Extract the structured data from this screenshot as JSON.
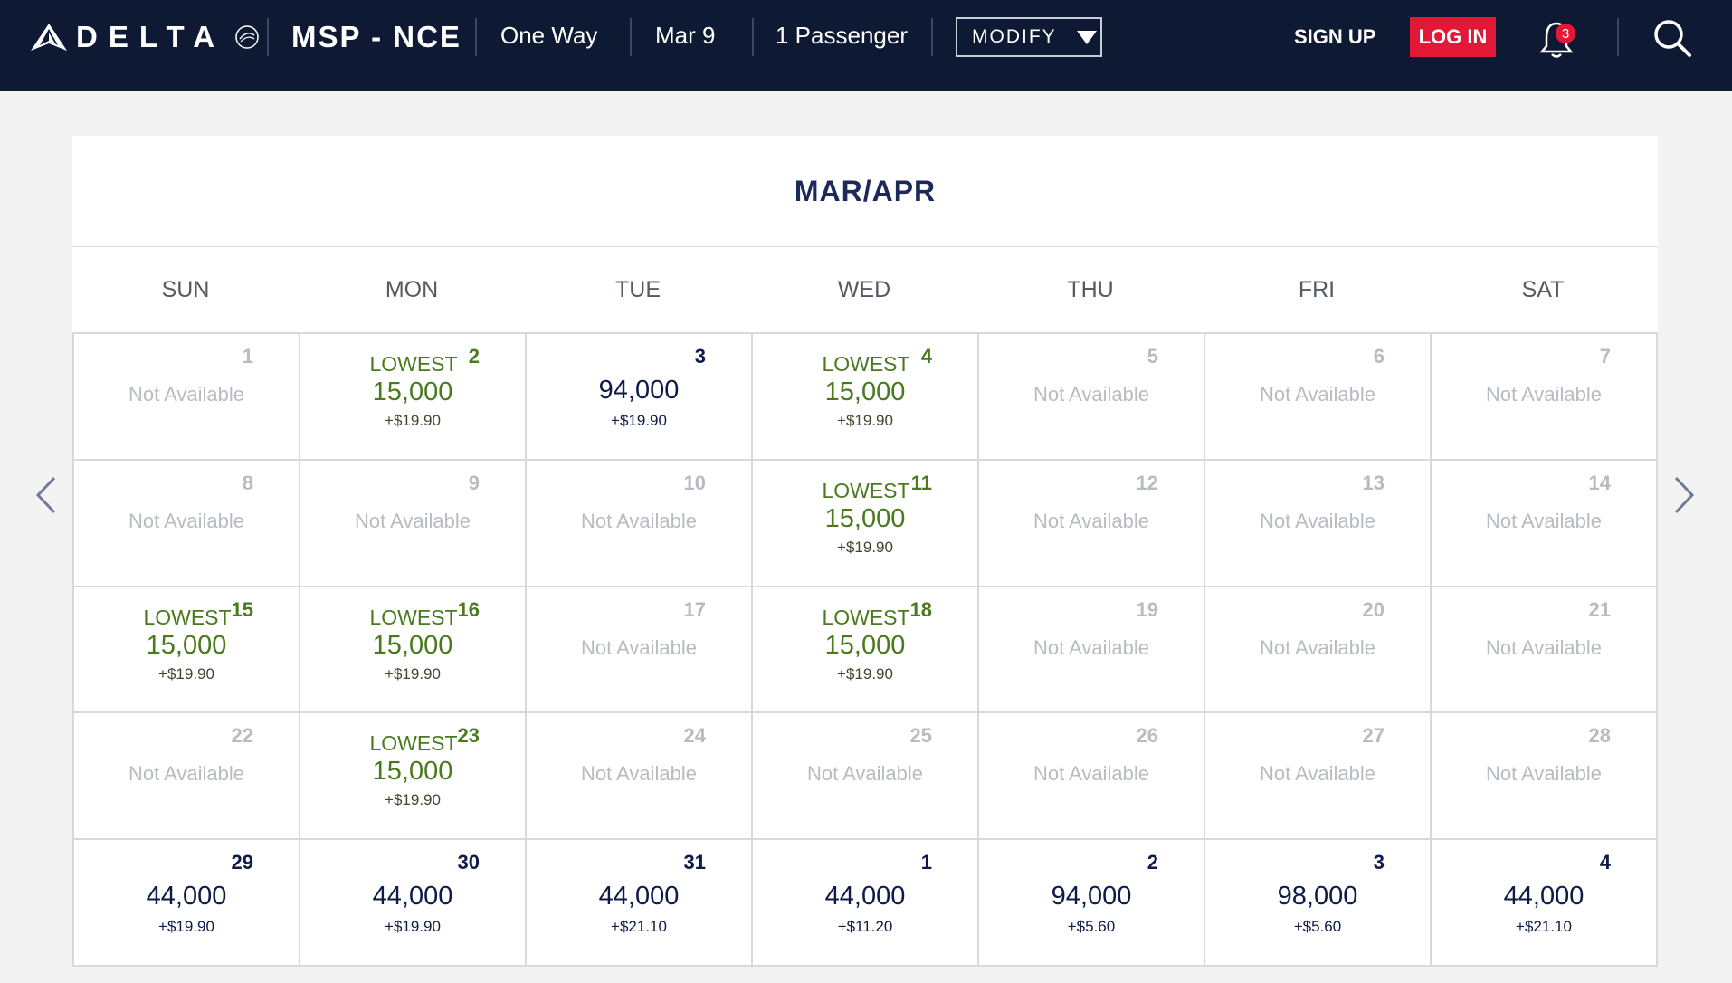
{
  "header": {
    "logo_text": "DELTA",
    "route": "MSP - NCE",
    "trip_type": "One Way",
    "date": "Mar 9",
    "passengers": "1 Passenger",
    "modify_label": "MODIFY",
    "signup_label": "SIGN UP",
    "login_label": "LOG IN",
    "notification_count": "3",
    "colors": {
      "bar": "#0e1a33",
      "login": "#e31837"
    }
  },
  "calendar": {
    "title": "MAR/APR",
    "weekdays": [
      "SUN",
      "MON",
      "TUE",
      "WED",
      "THU",
      "FRI",
      "SAT"
    ],
    "not_available_label": "Not Available",
    "lowest_label": "LOWEST",
    "days": [
      {
        "day": "1",
        "status": "na"
      },
      {
        "day": "2",
        "status": "lowest",
        "miles": "15,000",
        "fee": "+$19.90"
      },
      {
        "day": "3",
        "status": "regular",
        "miles": "94,000",
        "fee": "+$19.90"
      },
      {
        "day": "4",
        "status": "lowest",
        "miles": "15,000",
        "fee": "+$19.90"
      },
      {
        "day": "5",
        "status": "na"
      },
      {
        "day": "6",
        "status": "na"
      },
      {
        "day": "7",
        "status": "na"
      },
      {
        "day": "8",
        "status": "na"
      },
      {
        "day": "9",
        "status": "na"
      },
      {
        "day": "10",
        "status": "na"
      },
      {
        "day": "11",
        "status": "lowest",
        "miles": "15,000",
        "fee": "+$19.90"
      },
      {
        "day": "12",
        "status": "na"
      },
      {
        "day": "13",
        "status": "na"
      },
      {
        "day": "14",
        "status": "na"
      },
      {
        "day": "15",
        "status": "lowest",
        "miles": "15,000",
        "fee": "+$19.90"
      },
      {
        "day": "16",
        "status": "lowest",
        "miles": "15,000",
        "fee": "+$19.90"
      },
      {
        "day": "17",
        "status": "na"
      },
      {
        "day": "18",
        "status": "lowest",
        "miles": "15,000",
        "fee": "+$19.90"
      },
      {
        "day": "19",
        "status": "na"
      },
      {
        "day": "20",
        "status": "na"
      },
      {
        "day": "21",
        "status": "na"
      },
      {
        "day": "22",
        "status": "na"
      },
      {
        "day": "23",
        "status": "lowest",
        "miles": "15,000",
        "fee": "+$19.90"
      },
      {
        "day": "24",
        "status": "na"
      },
      {
        "day": "25",
        "status": "na"
      },
      {
        "day": "26",
        "status": "na"
      },
      {
        "day": "27",
        "status": "na"
      },
      {
        "day": "28",
        "status": "na"
      },
      {
        "day": "29",
        "status": "regular",
        "miles": "44,000",
        "fee": "+$19.90"
      },
      {
        "day": "30",
        "status": "regular",
        "miles": "44,000",
        "fee": "+$19.90"
      },
      {
        "day": "31",
        "status": "regular",
        "miles": "44,000",
        "fee": "+$21.10"
      },
      {
        "day": "1",
        "status": "regular",
        "miles": "44,000",
        "fee": "+$11.20"
      },
      {
        "day": "2",
        "status": "regular",
        "miles": "94,000",
        "fee": "+$5.60"
      },
      {
        "day": "3",
        "status": "regular",
        "miles": "98,000",
        "fee": "+$5.60"
      },
      {
        "day": "4",
        "status": "regular",
        "miles": "44,000",
        "fee": "+$21.10"
      }
    ]
  }
}
